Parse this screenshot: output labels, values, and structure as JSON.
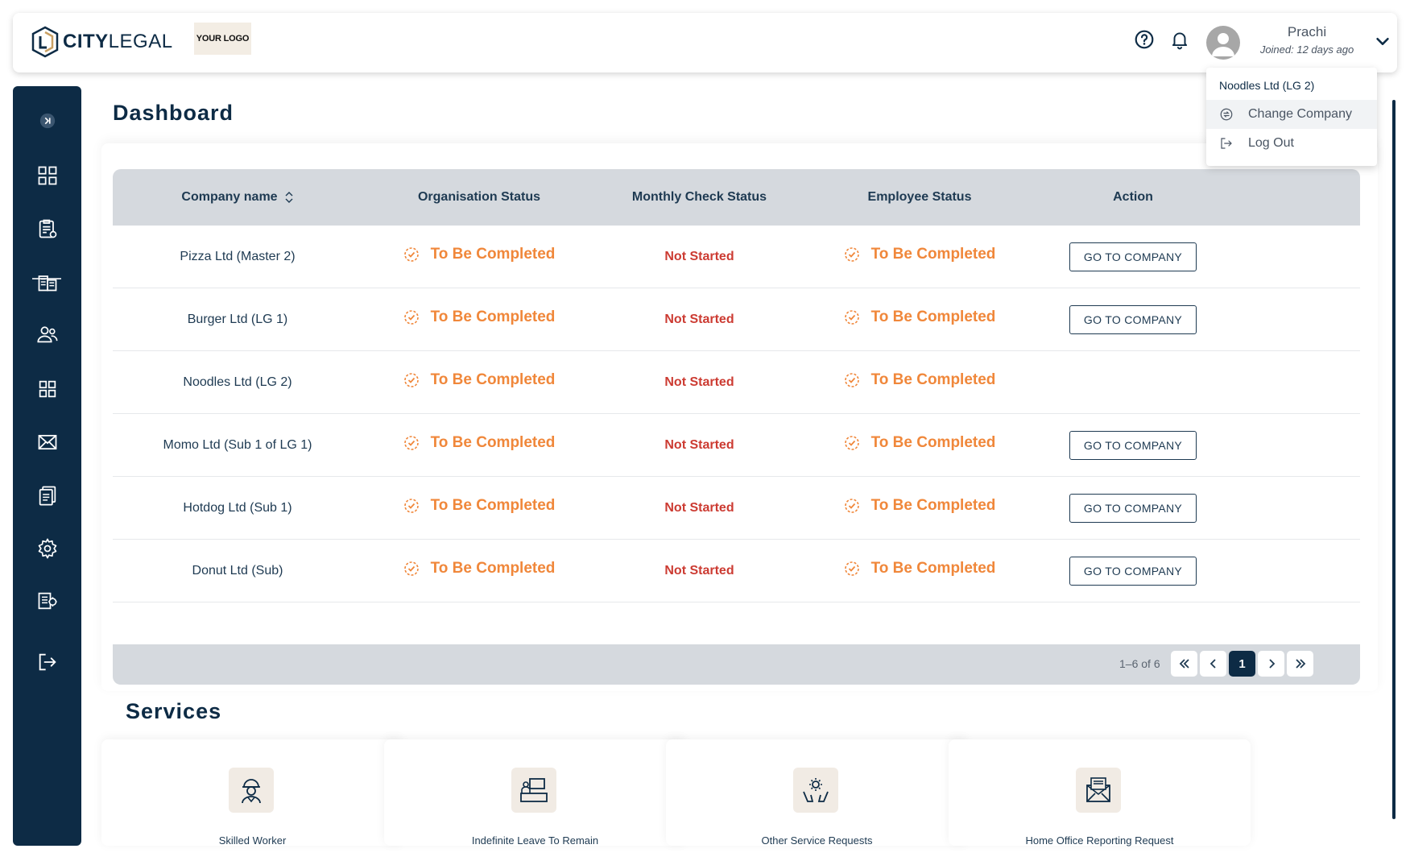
{
  "colors": {
    "navy": "#0d2b45",
    "orange": "#f0873a",
    "red": "#cc3b32",
    "header_gray": "#d5d9de"
  },
  "brand": {
    "name_bold": "CITY",
    "name_light": "LEGAL",
    "your_logo": "YOUR LOGO"
  },
  "topbar": {
    "icons": [
      "help-circle-icon",
      "bell-icon"
    ]
  },
  "user": {
    "name": "Prachi",
    "joined": "Joined: 12 days ago"
  },
  "dropdown": {
    "current_company": "Noodles Ltd (LG 2)",
    "change_company": "Change Company",
    "log_out": "Log Out"
  },
  "page": {
    "title": "Dashboard"
  },
  "table": {
    "headers": {
      "company": "Company name",
      "organisation": "Organisation Status",
      "monthly": "Monthly Check Status",
      "employee": "Employee Status",
      "action": "Action"
    },
    "rows": [
      {
        "company": "Pizza Ltd (Master 2)",
        "org_status": "To Be Completed",
        "monthly": "Not Started",
        "emp_status": "To Be Completed",
        "action": "GO TO COMPANY"
      },
      {
        "company": "Burger Ltd (LG 1)",
        "org_status": "To Be Completed",
        "monthly": "Not Started",
        "emp_status": "To Be Completed",
        "action": "GO TO COMPANY"
      },
      {
        "company": "Noodles Ltd (LG 2)",
        "org_status": "To Be Completed",
        "monthly": "Not Started",
        "emp_status": "To Be Completed",
        "action": ""
      },
      {
        "company": "Momo Ltd (Sub 1 of LG 1)",
        "org_status": "To Be Completed",
        "monthly": "Not Started",
        "emp_status": "To Be Completed",
        "action": "GO TO COMPANY"
      },
      {
        "company": "Hotdog Ltd (Sub 1)",
        "org_status": "To Be Completed",
        "monthly": "Not Started",
        "emp_status": "To Be Completed",
        "action": "GO TO COMPANY"
      },
      {
        "company": "Donut Ltd (Sub)",
        "org_status": "To Be Completed",
        "monthly": "Not Started",
        "emp_status": "To Be Completed",
        "action": "GO TO COMPANY"
      }
    ],
    "pagination": {
      "range": "1–6 of 6",
      "current_page": "1"
    }
  },
  "services": {
    "title": "Services",
    "cards": [
      {
        "label": "Skilled Worker",
        "icon": "worker-icon"
      },
      {
        "label": "Indefinite Leave To Remain",
        "icon": "desk-computer-icon"
      },
      {
        "label": "Other Service Requests",
        "icon": "gear-hands-icon"
      },
      {
        "label": "Home Office Reporting Request",
        "icon": "mail-report-icon"
      }
    ]
  },
  "sidebar": {
    "icons": [
      "expand-icon",
      "dashboard-icon",
      "checklist-icon",
      "buildings-icon",
      "users-icon",
      "grid-icon",
      "mail-icon",
      "documents-icon",
      "settings-icon",
      "records-icon",
      "logout-icon"
    ]
  }
}
